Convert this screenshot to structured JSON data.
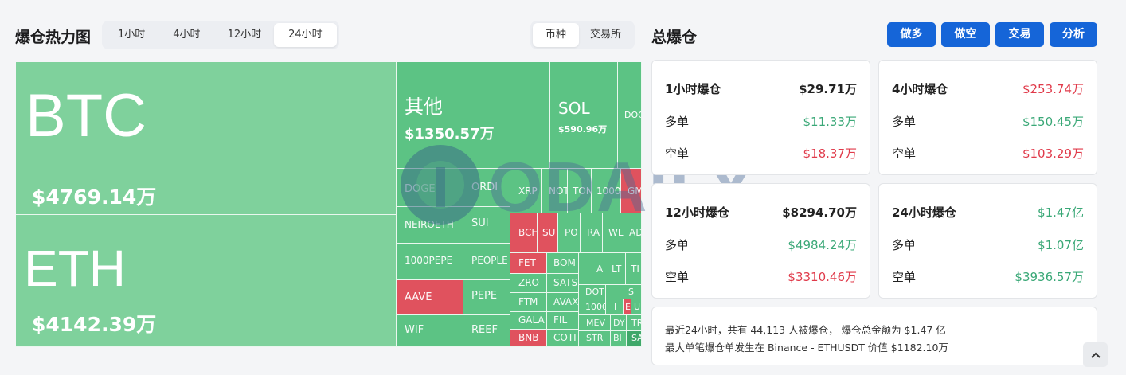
{
  "heatmap": {
    "title": "爆仓热力图",
    "time_tabs": [
      "1小时",
      "4小时",
      "12小时",
      "24小时"
    ],
    "active_time": "24小时",
    "group_tabs": [
      "币种",
      "交易所"
    ],
    "active_group": "币种",
    "big": [
      {
        "symbol": "BTC",
        "amount": "$4769.14万"
      },
      {
        "symbol": "ETH",
        "amount": "$4142.39万"
      },
      {
        "symbol": "其他",
        "amount": "$1350.57万"
      },
      {
        "symbol": "SOL",
        "amount": "$590.96万"
      }
    ],
    "small": {
      "doge": "DOGE",
      "ordi": "ORDI",
      "neiroeth": "NEIROETH",
      "sui": "SUI",
      "pepe1000": "1000PEPE",
      "people": "PEOPLE",
      "aave": "AAVE",
      "pepe": "PEPE",
      "wif": "WIF",
      "reef": "REEF",
      "xrp": "XRP",
      "not": "NOT",
      "ton": "TON",
      "k1000": "1000",
      "gm": "GM",
      "doc": "DOC",
      "bch": "BCH",
      "su": "SU",
      "po": "PO",
      "ra": "RA",
      "wl": "WL",
      "ad": "AD",
      "fet": "FET",
      "bom": "BOM",
      "zro": "ZRO",
      "sats": "SATS",
      "ftm": "FTM",
      "avax": "AVAX",
      "gala": "GALA",
      "fil": "FIL",
      "bnb": "BNB",
      "coti": "COTI",
      "dot": "DOT",
      "k1000b": "1000",
      "mev": "MEV",
      "str": "STR",
      "a": "A",
      "lt": "LT",
      "ti": "TI",
      "s": "S",
      "i": "I",
      "e": "E",
      "u": "U",
      "dy": "DY",
      "tr": "TR",
      "bi": "BI",
      "sa": "SA"
    }
  },
  "summary": {
    "title": "总爆仓",
    "actions": [
      "做多",
      "做空",
      "交易",
      "分析"
    ],
    "long_label": "多单",
    "short_label": "空单",
    "cards": [
      {
        "label": "1小时爆仓",
        "total": "$29.71万",
        "long": "$11.33万",
        "short": "$18.37万"
      },
      {
        "label": "4小时爆仓",
        "total": "$253.74万",
        "long": "$150.45万",
        "short": "$103.29万"
      },
      {
        "label": "12小时爆仓",
        "total": "$8294.70万",
        "long": "$4984.24万",
        "short": "$3310.46万"
      },
      {
        "label": "24小时爆仓",
        "total": "$1.47亿",
        "long": "$1.07亿",
        "short": "$3936.57万"
      }
    ],
    "note_line1": "最近24小时，共有 44,113 人被爆仓， 爆仓总金额为 $1.47 亿",
    "note_line2": "最大单笔爆仓单发生在 Binance - ETHUSDT 价值 $1182.10万"
  },
  "watermark": "ODAILY",
  "colors": {
    "green": "#5cc384",
    "red": "#e0525e",
    "blue": "#1565d8"
  }
}
